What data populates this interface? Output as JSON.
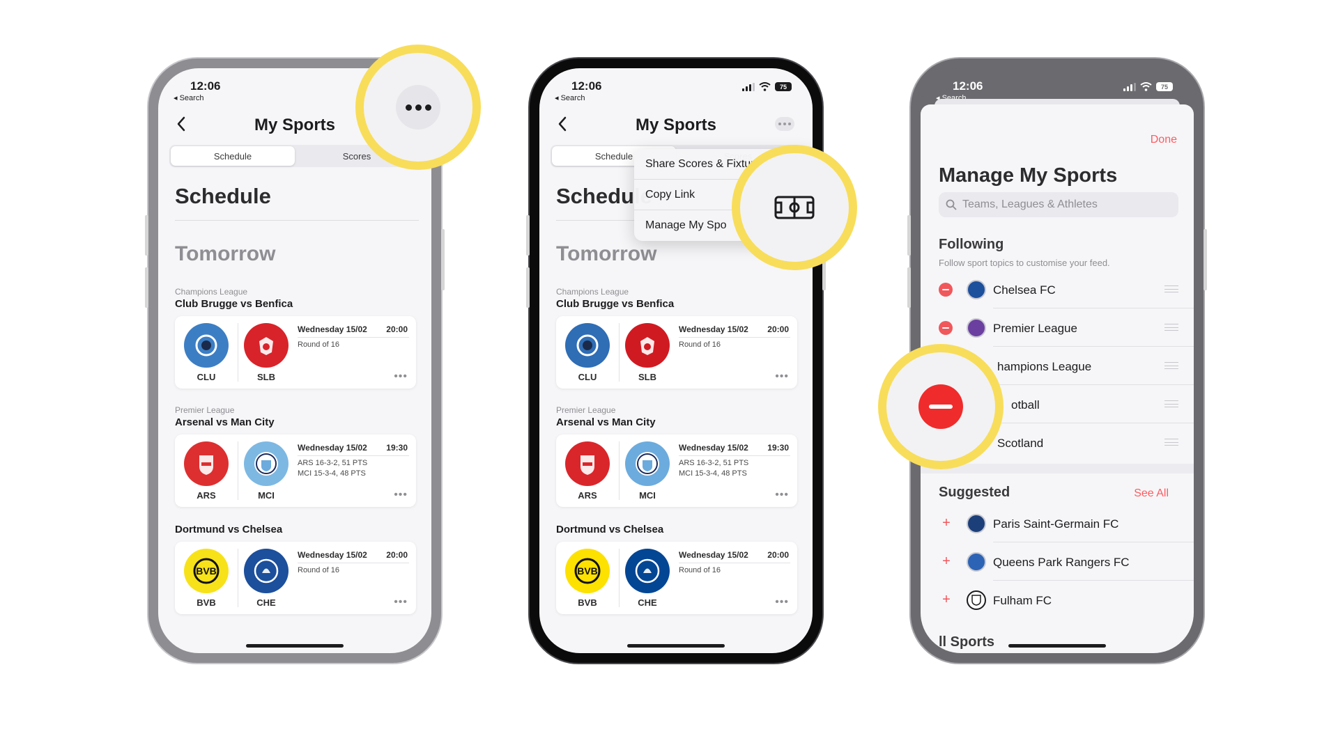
{
  "status": {
    "time": "12:06",
    "back": "◂ Search",
    "battery": "75"
  },
  "nav": {
    "title": "My Sports"
  },
  "segments": {
    "schedule": "Schedule",
    "scores": "Scores"
  },
  "schedule": {
    "heading": "Schedule",
    "day": "Tomorrow",
    "matches": [
      {
        "league": "Champions League",
        "fixture": "Club Brugge vs Benfica",
        "home": {
          "abbr": "CLU",
          "color": "#3c7ec4"
        },
        "away": {
          "abbr": "SLB",
          "color": "#d8232a"
        },
        "date": "Wednesday 15/02",
        "time": "20:00",
        "line1": "Round of 16",
        "line2": ""
      },
      {
        "league": "Premier League",
        "fixture": "Arsenal vs Man City",
        "home": {
          "abbr": "ARS",
          "color": "#dd2f30"
        },
        "away": {
          "abbr": "MCI",
          "color": "#7db8e3"
        },
        "date": "Wednesday 15/02",
        "time": "19:30",
        "line1": "ARS 16-3-2, 51 PTS",
        "line2": "MCI 15-3-4, 48 PTS"
      },
      {
        "league": "",
        "fixture": "Dortmund vs Chelsea",
        "home": {
          "abbr": "BVB",
          "color": "#f7e21a"
        },
        "away": {
          "abbr": "CHE",
          "color": "#1c4f9c"
        },
        "date": "Wednesday 15/02",
        "time": "20:00",
        "line1": "Round of 16",
        "line2": ""
      }
    ],
    "more": "•••"
  },
  "menu": {
    "share": "Share Scores & Fixtures",
    "copy": "Copy Link",
    "manage": "Manage My Spo"
  },
  "manage": {
    "done": "Done",
    "title": "Manage My Sports",
    "search_placeholder": "Teams, Leagues & Athletes",
    "following_heading": "Following",
    "following_sub": "Follow sport topics to customise your feed.",
    "following": [
      {
        "label": "Chelsea FC",
        "color": "#1c4f9c"
      },
      {
        "label": "Premier League",
        "color": "#6b3fa0"
      },
      {
        "label": "hampions League",
        "color": "#ffffff"
      },
      {
        "label": "otball",
        "color": "#ffffff"
      },
      {
        "label": "Scotland",
        "color": "#ffffff"
      }
    ],
    "suggested_heading": "Suggested",
    "see_all": "See All",
    "suggested": [
      {
        "label": "Paris Saint-Germain FC",
        "color": "#1c3f7a"
      },
      {
        "label": "Queens Park Rangers FC",
        "color": "#2c63b5"
      },
      {
        "label": "Fulham FC",
        "color": "#ffffff"
      }
    ],
    "all_sports": "ll Sports"
  },
  "colors": {
    "highlight": "#f8dd5a",
    "accent": "#ff5a5f",
    "minus": "#f0575b"
  }
}
